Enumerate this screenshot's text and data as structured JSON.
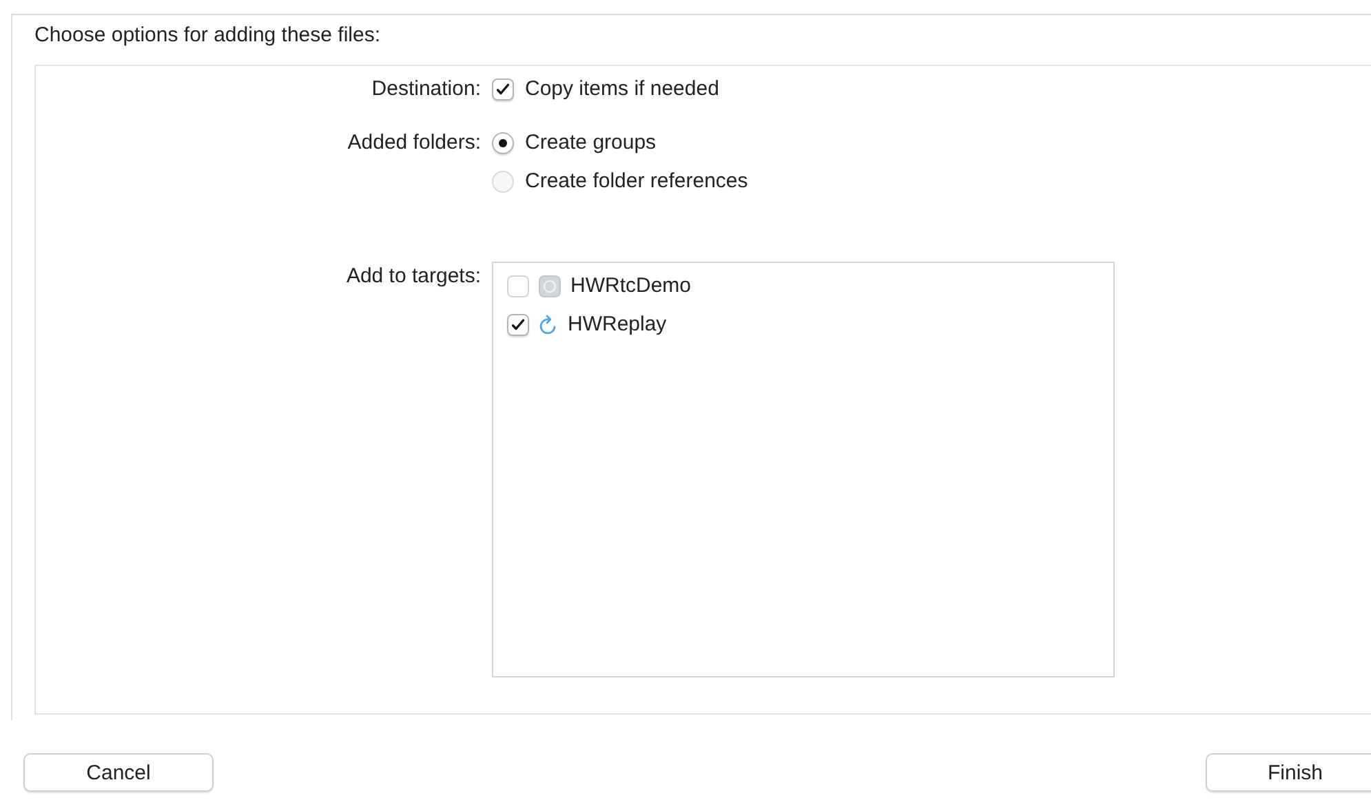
{
  "title": "Choose options for adding these files:",
  "options": [
    {
      "kind": "checkbox",
      "label": "Destination:",
      "items": [
        {
          "label": "Copy items if needed",
          "checked": true
        }
      ]
    },
    {
      "kind": "radio",
      "label": "Added folders:",
      "items": [
        {
          "label": "Create groups",
          "selected": true
        },
        {
          "label": "Create folder references",
          "selected": false
        }
      ]
    }
  ],
  "targets": {
    "label": "Add to targets:",
    "items": [
      {
        "name": "HWRtcDemo",
        "checked": false,
        "kind": "app"
      },
      {
        "name": "HWReplay",
        "checked": true,
        "kind": "refresh"
      }
    ]
  },
  "buttons": [
    {
      "label": "Cancel"
    },
    {
      "label": "Finish"
    }
  ]
}
